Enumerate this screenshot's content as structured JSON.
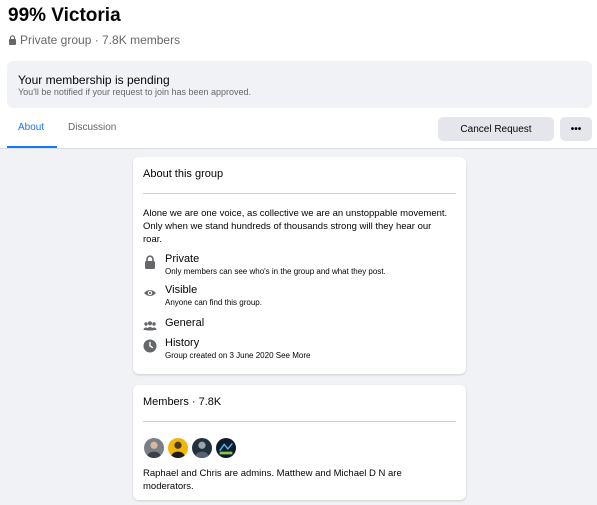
{
  "group": {
    "name": "99% Victoria",
    "privacy": "Private group",
    "members_count": "7.8K members"
  },
  "pending": {
    "heading": "Your membership is pending",
    "subtext": "You'll be notified if your request to join has been approved."
  },
  "tabs": [
    {
      "label": "About",
      "active": true
    },
    {
      "label": "Discussion",
      "active": false
    }
  ],
  "actions": {
    "cancel_label": "Cancel Request",
    "more_label": "•••"
  },
  "about": {
    "title": "About this group",
    "description": "Alone we are one voice, as collective we are an unstoppable movement. Only when we stand hundreds of thousands strong will they hear our roar.",
    "items": [
      {
        "icon": "lock-icon",
        "title": "Private",
        "detail": "Only members can see who's in the group and what they post."
      },
      {
        "icon": "eye-icon",
        "title": "Visible",
        "detail": "Anyone can find this group."
      },
      {
        "icon": "people-icon",
        "title": "General",
        "detail": ""
      },
      {
        "icon": "clock-icon",
        "title": "History",
        "detail": "Group created on 3 June 2020 See More"
      }
    ]
  },
  "members": {
    "title": "Members · 7.8K",
    "admins_text": "Raphael and Chris are admins. Matthew and Michael D N are moderators."
  },
  "colors": {
    "accent": "#1877f2",
    "background": "#f0f2f5",
    "secondary_text": "#65676b"
  }
}
